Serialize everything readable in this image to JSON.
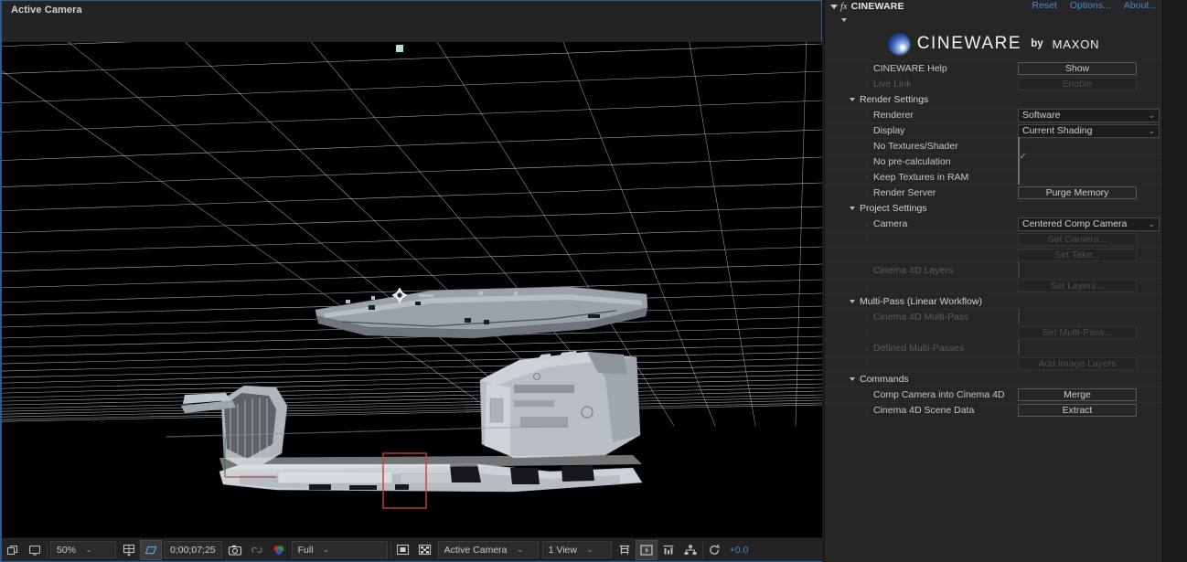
{
  "viewport": {
    "camera_label": "Active Camera",
    "scene_description": "3D grayscale spaceship / vehicle hull wireframe model over perspective ground grid",
    "selection_box_color": "#d03a3a",
    "axis_green": "#3f7a3f",
    "axis_red": "#a03030",
    "marker_color": "#b8dcd8"
  },
  "bottom_toolbar": {
    "icons": {
      "layers": "layers-icon",
      "monitor": "monitor-icon",
      "resolution": "resolution-icon",
      "region_of_interest": "region-of-interest-icon",
      "snapshot": "camera-snapshot-icon",
      "show_snapshot": "show-snapshot-icon",
      "channels": "channel-rgb-icon",
      "mask_alpha": "alpha-boundary-icon",
      "transparency_grid": "transparency-grid-icon",
      "guides": "guides-icon",
      "fast_previews": "fast-previews-icon",
      "timeline_graph": "timeline-graph-icon",
      "comp_flowchart": "comp-flowchart-icon",
      "refresh": "refresh-icon"
    },
    "zoom_value": "50%",
    "timecode": "0;00;07;25",
    "resolution_value": "Full",
    "view_camera_value": "Active Camera",
    "view_layout_value": "1 View",
    "exposure_value": "+0.0"
  },
  "effect_panel": {
    "fx_marker": "fx",
    "effect_name": "CINEWARE",
    "links": [
      "Reset",
      "Options...",
      "About..."
    ],
    "brand": {
      "product": "CINEWARE",
      "by": "by",
      "company": "MAXON"
    },
    "sections": [
      {
        "id": "top",
        "title": null,
        "rows": [
          {
            "label": "CINEWARE Help",
            "type": "button",
            "value": "Show",
            "enabled": true
          },
          {
            "label": "Live Link",
            "type": "button",
            "value": "Enable",
            "enabled": false
          }
        ]
      },
      {
        "id": "render-settings",
        "title": "Render Settings",
        "rows": [
          {
            "label": "Renderer",
            "type": "dropdown",
            "value": "Software",
            "enabled": true
          },
          {
            "label": "Display",
            "type": "dropdown",
            "value": "Current Shading",
            "enabled": true
          },
          {
            "label": "No Textures/Shader",
            "type": "checkbox",
            "value": false,
            "enabled": true
          },
          {
            "label": "No pre-calculation",
            "type": "checkbox",
            "value": true,
            "enabled": true
          },
          {
            "label": "Keep Textures in RAM",
            "type": "checkbox",
            "value": false,
            "enabled": true
          },
          {
            "label": "Render Server",
            "type": "button",
            "value": "Purge Memory",
            "enabled": true
          }
        ]
      },
      {
        "id": "project-settings",
        "title": "Project Settings",
        "rows": [
          {
            "label": "Camera",
            "type": "dropdown",
            "value": "Centered Comp Camera",
            "enabled": true
          },
          {
            "label": "",
            "type": "button",
            "value": "Set Camera...",
            "enabled": false
          },
          {
            "label": "",
            "type": "button",
            "value": "Set Take...",
            "enabled": false
          },
          {
            "label": "Cinema 4D Layers",
            "type": "checkbox",
            "value": false,
            "enabled": false
          },
          {
            "label": "",
            "type": "button",
            "value": "Set Layers...",
            "enabled": false
          }
        ]
      },
      {
        "id": "multi-pass",
        "title": "Multi-Pass (Linear Workflow)",
        "rows": [
          {
            "label": "Cinema 4D Multi-Pass",
            "type": "checkbox",
            "value": false,
            "enabled": false
          },
          {
            "label": "",
            "type": "button",
            "value": "Set Multi-Pass...",
            "enabled": false
          },
          {
            "label": "Defined Multi-Passes",
            "type": "checkbox",
            "value": false,
            "enabled": false
          },
          {
            "label": "",
            "type": "button",
            "value": "Add Image Layers",
            "enabled": false
          }
        ]
      },
      {
        "id": "commands",
        "title": "Commands",
        "rows": [
          {
            "label": "Comp Camera into Cinema 4D",
            "type": "button",
            "value": "Merge",
            "enabled": true
          },
          {
            "label": "Cinema 4D Scene Data",
            "type": "button",
            "value": "Extract",
            "enabled": true
          }
        ]
      }
    ]
  },
  "colors": {
    "panel_bg": "#262626",
    "viewport_bg": "#000000",
    "accent_blue": "#4b87c8",
    "active_border": "#2c5b8f"
  }
}
